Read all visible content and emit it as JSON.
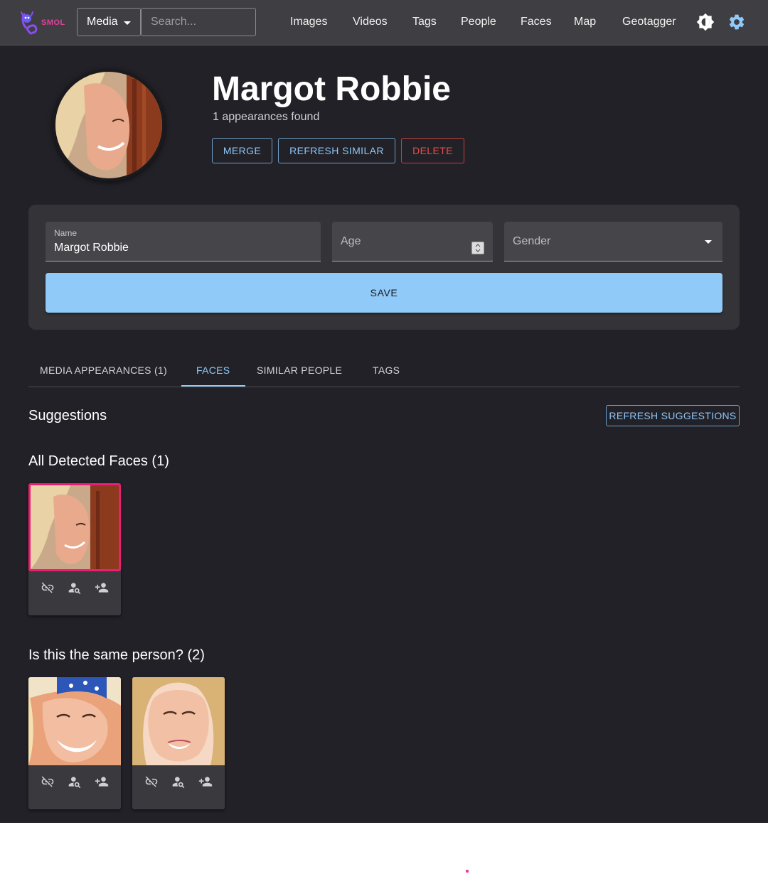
{
  "navbar": {
    "logo_text": "SMOL",
    "media_menu_label": "Media",
    "search_placeholder": "Search...",
    "links": [
      "Images",
      "Videos",
      "Tags",
      "People",
      "Faces",
      "Map",
      "Geotagger"
    ],
    "theme_icon": "brightness-icon",
    "settings_icon": "gear-icon"
  },
  "person": {
    "name": "Margot Robbie",
    "appearances_text": "1 appearances found",
    "actions": {
      "merge": "MERGE",
      "refresh_similar": "REFRESH SIMILAR",
      "delete": "DELETE"
    }
  },
  "form": {
    "name_label": "Name",
    "name_value": "Margot Robbie",
    "age_placeholder": "Age",
    "gender_placeholder": "Gender",
    "save_label": "SAVE"
  },
  "tabs": [
    {
      "label": "MEDIA APPEARANCES (1)",
      "active": false
    },
    {
      "label": "FACES",
      "active": true
    },
    {
      "label": "SIMILAR PEOPLE",
      "active": false
    },
    {
      "label": "TAGS",
      "active": false
    }
  ],
  "suggestions": {
    "title": "Suggestions",
    "refresh_label": "REFRESH SUGGESTIONS"
  },
  "detected_faces": {
    "title": "All Detected Faces (1)"
  },
  "same_person": {
    "title": "Is this the same person? (2)"
  },
  "face_actions": [
    "unlink-icon",
    "find-person-icon",
    "add-person-icon"
  ],
  "colors": {
    "accent": "#90caf9",
    "danger": "#e5504d",
    "selected_border": "#e91e74",
    "background": "#222127",
    "navbar": "#3f3f43"
  }
}
